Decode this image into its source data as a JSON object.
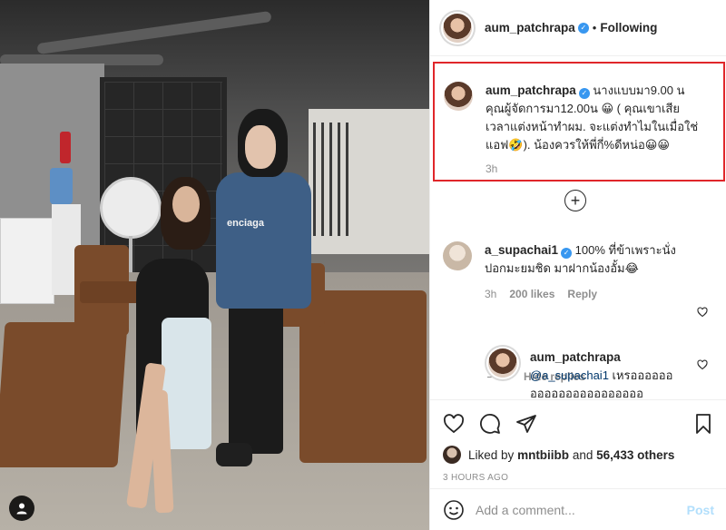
{
  "post": {
    "author": "aum_patchrapa",
    "follow_separator": "•",
    "follow_status": "Following"
  },
  "caption": {
    "username": "aum_patchrapa",
    "line1": "นางแบบมา9.00 น",
    "line2": "คุณผู้จัดการมา12.00น 😀 ( คุณเขาเสีย",
    "line3": "เวลาแต่งหน้าทำผม. จะแต่งทำไมในเมื่อใช่",
    "line4": "แอฟ🤣). น้องควรให้พี่กี่%ดีหน่อ😀😀",
    "time": "3h"
  },
  "load_more_symbol": "+",
  "comments": [
    {
      "username": "a_supachai1",
      "text_line1": "100% ที่ข้าเพราะนั่ง",
      "text_line2": "ปอกมะยมชิด มาฝากน้องอั้ม😂",
      "time": "3h",
      "likes": "200 likes",
      "reply": "Reply"
    }
  ],
  "hide_replies": "Hide replies",
  "reply": {
    "username": "aum_patchrapa",
    "mention": "@a_supachai1",
    "text_line1": " เหรออออออ",
    "text_line2": "ออออออออออออออออ"
  },
  "likes": {
    "prefix": "Liked by",
    "user": "mntbiibb",
    "and": "and",
    "count": "56,433 others"
  },
  "time_ago": "3 HOURS AGO",
  "composer": {
    "placeholder": "Add a comment...",
    "post_label": "Post"
  },
  "photo_brand_text": "enciaga",
  "colors": {
    "highlight_border": "#e0262a",
    "verified": "#3897f0",
    "muted": "#8e8e8e",
    "post_disabled": "#b2dffc"
  }
}
